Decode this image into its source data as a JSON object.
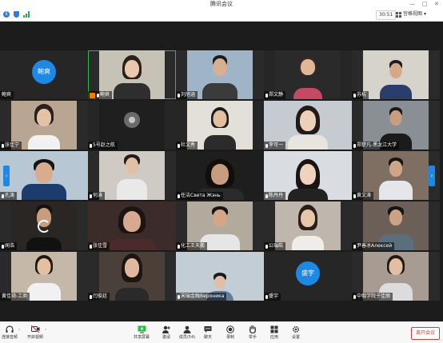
{
  "window": {
    "title": "腾讯会议"
  },
  "header": {
    "timer": "30:51",
    "view_mode": "宫格视图"
  },
  "colors": {
    "accent": "#1e88e5",
    "speaking_border": "#2db84b",
    "host_badge": "#f07c00",
    "leave": "#e53935"
  },
  "participants": [
    {
      "name": "鲍爽",
      "avatar_text": "鲍爽",
      "muted": false
    },
    {
      "name": "鲍爽",
      "muted": true,
      "host": true
    },
    {
      "name": "刘旭涵",
      "muted": true
    },
    {
      "name": "郑文静",
      "muted": true
    },
    {
      "name": "苏杭",
      "muted": true
    },
    {
      "name": "张佳宁",
      "muted": true
    },
    {
      "name": "5号赵之航",
      "muted": true
    },
    {
      "name": "杜文秀",
      "muted": true
    },
    {
      "name": "李可一",
      "muted": true
    },
    {
      "name": "郑楚凡-黑龙江大学",
      "muted": true
    },
    {
      "name": "孔涛",
      "muted": true
    },
    {
      "name": "何涛",
      "muted": true
    },
    {
      "name": "任洁Света Жэнь",
      "muted": true
    },
    {
      "name": "陈丹丹",
      "muted": true
    },
    {
      "name": "黄文涛",
      "muted": true
    },
    {
      "name": "闻浩",
      "muted": true
    },
    {
      "name": "张佳雪",
      "muted": true
    },
    {
      "name": "化工王天鹏",
      "muted": true
    },
    {
      "name": "公瑞皓",
      "muted": true
    },
    {
      "name": "尹善冰Алексей",
      "muted": true
    },
    {
      "name": "黄佳琦-工商",
      "muted": false
    },
    {
      "name": "闫俊廷",
      "muted": true
    },
    {
      "name": "宋瑞金融Вероника",
      "muted": true
    },
    {
      "name": "盛宇",
      "avatar_text": "盛宇",
      "muted": true
    },
    {
      "name": "中俄学院于佳丽",
      "muted": true
    }
  ],
  "toolbar": {
    "items": [
      {
        "label": "连接音频",
        "icon": "headphone-icon"
      },
      {
        "label": "开启视频",
        "icon": "camera-off-icon"
      },
      {
        "label": "共享屏幕",
        "icon": "share-screen-icon"
      },
      {
        "label": "邀请",
        "icon": "invite-icon"
      },
      {
        "label": "成员(54)",
        "icon": "members-icon"
      },
      {
        "label": "聊天",
        "icon": "chat-icon"
      },
      {
        "label": "录制",
        "icon": "record-icon"
      },
      {
        "label": "举手",
        "icon": "raise-hand-icon"
      },
      {
        "label": "应用",
        "icon": "apps-icon"
      },
      {
        "label": "设置",
        "icon": "settings-icon"
      }
    ],
    "leave_label": "离开会议"
  }
}
